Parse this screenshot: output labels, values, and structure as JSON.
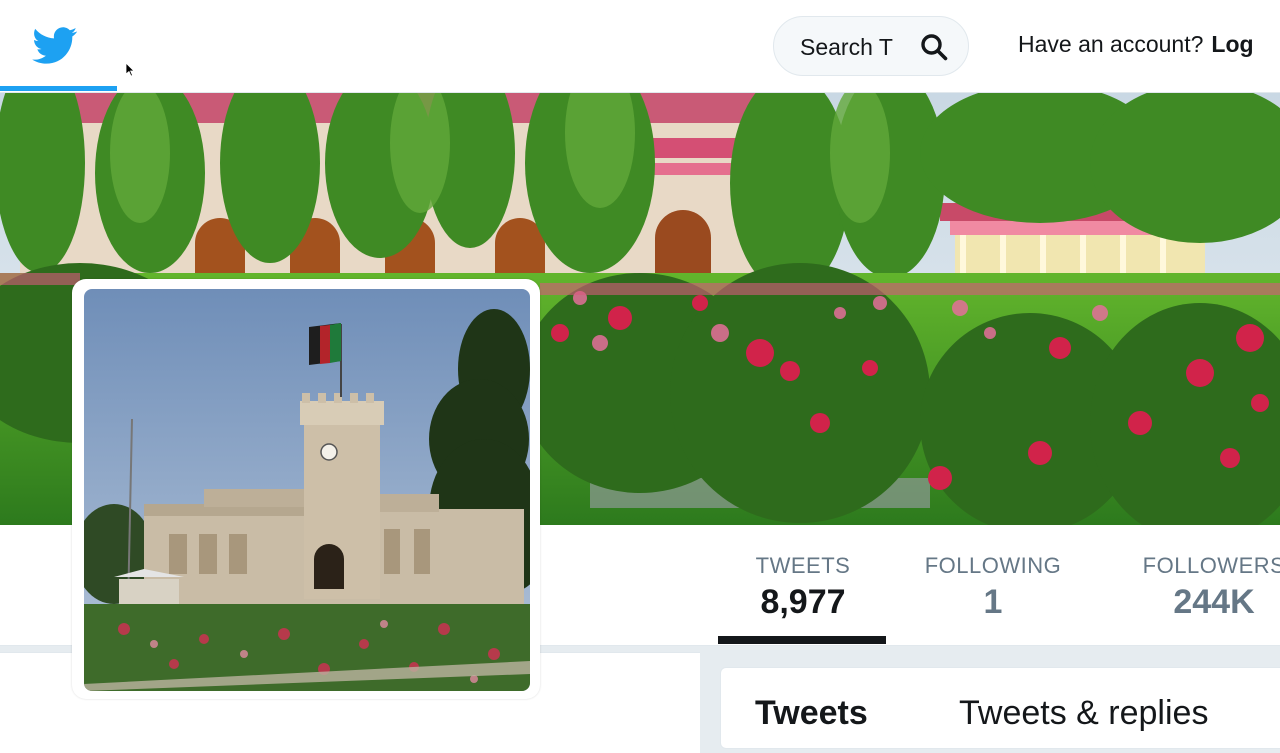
{
  "nav": {
    "search_placeholder": "Search T",
    "account_prompt": "Have an account?",
    "login_label": "Log",
    "brand_color": "#1da1f2",
    "icons": [
      "twitter-bird-icon",
      "search-icon",
      "mouse-cursor-icon"
    ]
  },
  "stats": {
    "tweets": {
      "label": "TWEETS",
      "value": "8,977"
    },
    "following": {
      "label": "FOLLOWING",
      "value": "1"
    },
    "followers": {
      "label": "FOLLOWERS",
      "value": "244K"
    }
  },
  "timeline_tabs": {
    "tweets": "Tweets",
    "replies": "Tweets & replies"
  }
}
